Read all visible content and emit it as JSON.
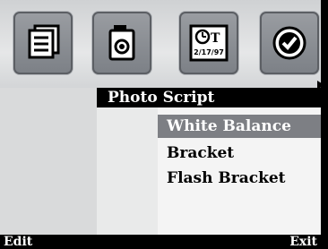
{
  "icons": [
    {
      "name": "menu-list-icon"
    },
    {
      "name": "camera-icon"
    },
    {
      "name": "date-time-icon",
      "date_text": "2/17/97",
      "label": "T"
    },
    {
      "name": "checkmark-icon"
    }
  ],
  "menu": {
    "title": "Photo Script",
    "items": [
      {
        "label": "White Balance",
        "selected": true
      },
      {
        "label": "Bracket",
        "selected": false
      },
      {
        "label": "Flash Bracket",
        "selected": false
      }
    ]
  },
  "softkeys": {
    "left": "Edit",
    "right": "Exit"
  },
  "colors": {
    "selection": "#7d7f84",
    "bar": "#000000"
  }
}
